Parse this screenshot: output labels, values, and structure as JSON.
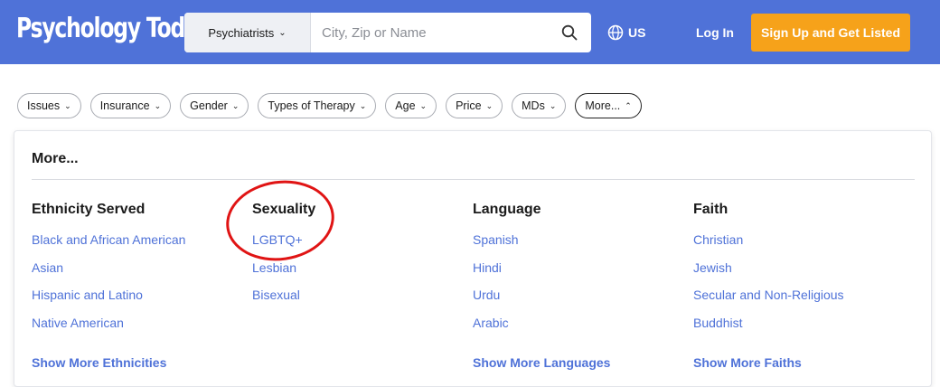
{
  "header": {
    "logo": "Psychology Today",
    "search_category": "Psychiatrists",
    "search_placeholder": "City, Zip or Name",
    "locale": "US",
    "login": "Log In",
    "signup": "Sign Up and Get Listed"
  },
  "filters": [
    "Issues",
    "Insurance",
    "Gender",
    "Types of Therapy",
    "Age",
    "Price",
    "MDs",
    "More..."
  ],
  "panel": {
    "title": "More...",
    "columns": [
      {
        "heading": "Ethnicity Served",
        "items": [
          "Black and African American",
          "Asian",
          "Hispanic and Latino",
          "Native American"
        ],
        "more": "Show More Ethnicities"
      },
      {
        "heading": "Sexuality",
        "items": [
          "LGBTQ+",
          "Lesbian",
          "Bisexual"
        ],
        "more": ""
      },
      {
        "heading": "Language",
        "items": [
          "Spanish",
          "Hindi",
          "Urdu",
          "Arabic"
        ],
        "more": "Show More Languages"
      },
      {
        "heading": "Faith",
        "items": [
          "Christian",
          "Jewish",
          "Secular and Non-Religious",
          "Buddhist"
        ],
        "more": "Show More Faiths"
      }
    ]
  },
  "colors": {
    "brand_blue": "#4f72d8",
    "signup_orange": "#f6a21a",
    "annotation_red": "#e01414"
  }
}
